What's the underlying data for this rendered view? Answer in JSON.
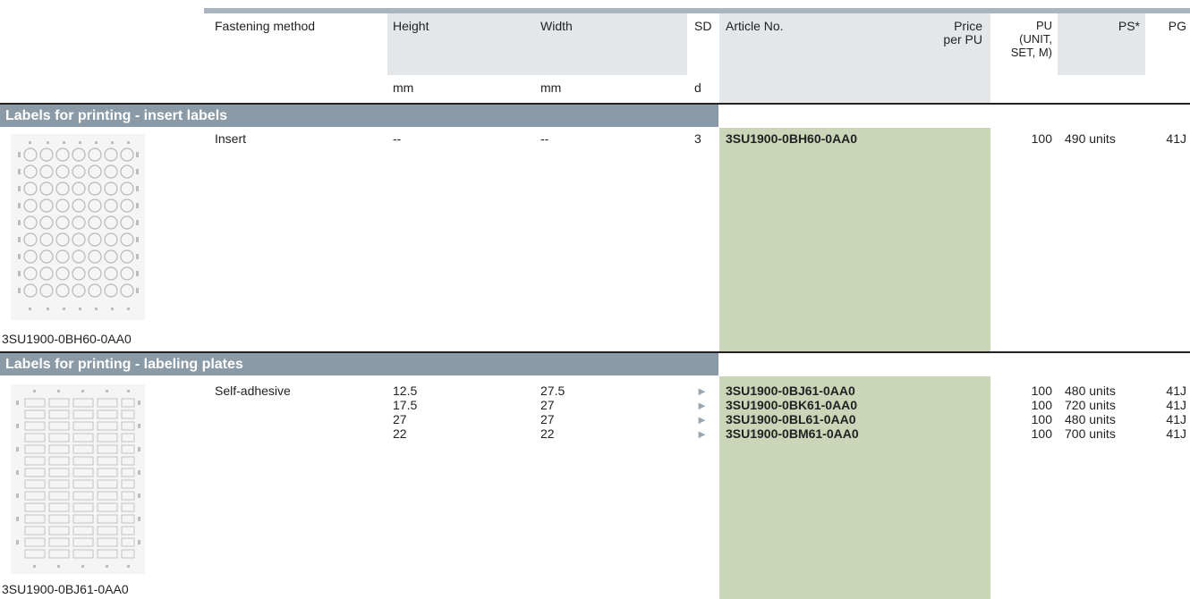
{
  "header": {
    "fastening_method": "Fastening method",
    "height": "Height",
    "width": "Width",
    "sd": "SD",
    "article_no": "Article No.",
    "price_line1": "Price",
    "price_line2": "per PU",
    "pu_line1": "PU",
    "pu_line2": "(UNIT,",
    "pu_line3": "SET, M)",
    "ps": "PS*",
    "pg": "PG",
    "unit_height": "mm",
    "unit_width": "mm",
    "unit_sd": "d"
  },
  "sections": [
    {
      "title": "Labels for printing - insert labels",
      "image_caption": "3SU1900-0BH60-0AA0",
      "fastening": "Insert",
      "rows": [
        {
          "height": "--",
          "width": "--",
          "sd": "3",
          "article": "3SU1900-0BH60-0AA0",
          "pu": "100",
          "ps": "490 units",
          "pg": "41J"
        }
      ]
    },
    {
      "title": "Labels for printing - labeling plates",
      "image_caption": "3SU1900-0BJ61-0AA0",
      "fastening": "Self-adhesive",
      "rows": [
        {
          "height": "12.5",
          "width": "27.5",
          "sd": "►",
          "article": "3SU1900-0BJ61-0AA0",
          "pu": "100",
          "ps": "480 units",
          "pg": "41J"
        },
        {
          "height": "17.5",
          "width": "27",
          "sd": "►",
          "article": "3SU1900-0BK61-0AA0",
          "pu": "100",
          "ps": "720 units",
          "pg": "41J"
        },
        {
          "height": "27",
          "width": "27",
          "sd": "►",
          "article": "3SU1900-0BL61-0AA0",
          "pu": "100",
          "ps": "480 units",
          "pg": "41J"
        },
        {
          "height": "22",
          "width": "22",
          "sd": "►",
          "article": "3SU1900-0BM61-0AA0",
          "pu": "100",
          "ps": "700 units",
          "pg": "41J"
        }
      ]
    }
  ],
  "colors": {
    "header_bg": "#e4e7ea",
    "article_bg": "#cbd5b7",
    "section_bg": "#8a9aa6",
    "top_rule": "#a9b6c2"
  }
}
